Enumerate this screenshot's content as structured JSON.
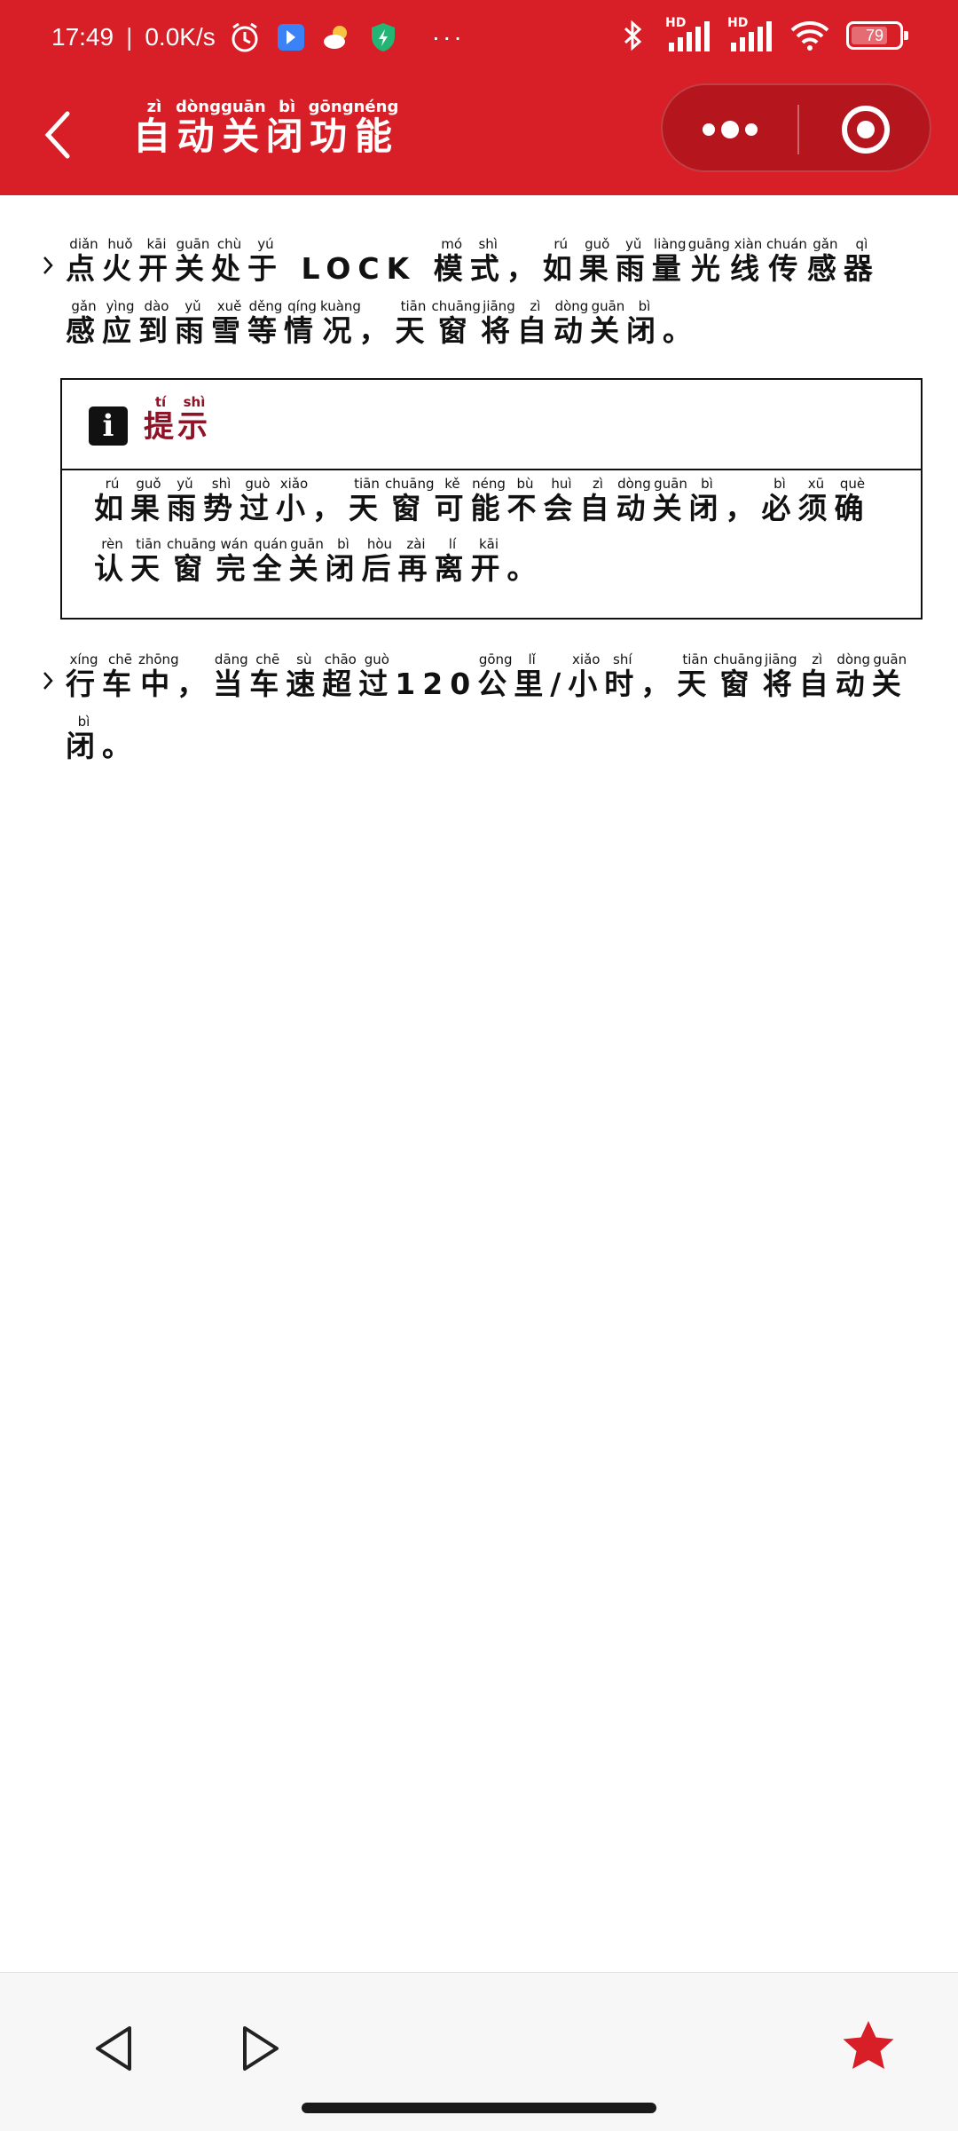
{
  "status_bar": {
    "time": "17:49",
    "separator": "|",
    "net_speed": "0.0K/s",
    "dots": "···",
    "hd_1": "HD",
    "hd_2": "HD",
    "battery": "79",
    "battery_level": 0.79
  },
  "nav": {
    "title": [
      {
        "char": "自",
        "py": "zì"
      },
      {
        "char": "动",
        "py": "dòng"
      },
      {
        "char": "关",
        "py": "guān"
      },
      {
        "char": "闭",
        "py": "bì"
      },
      {
        "char": "功",
        "py": "gōng"
      },
      {
        "char": "能",
        "py": "néng"
      }
    ]
  },
  "content": {
    "para1": [
      {
        "char": "点",
        "py": "diǎn"
      },
      {
        "char": "火",
        "py": "huǒ"
      },
      {
        "char": "开",
        "py": "kāi"
      },
      {
        "char": "关",
        "py": "guān"
      },
      {
        "char": "处",
        "py": "chù"
      },
      {
        "char": "于",
        "py": "yú"
      },
      {
        "char": " LOCK ",
        "py": ""
      },
      {
        "char": "模",
        "py": "mó"
      },
      {
        "char": "式",
        "py": "shì"
      },
      {
        "char": "，",
        "py": ""
      },
      {
        "char": "如",
        "py": "rú"
      },
      {
        "char": "果",
        "py": "guǒ"
      },
      {
        "char": "雨",
        "py": "yǔ"
      },
      {
        "char": "量",
        "py": "liàng"
      },
      {
        "char": "光",
        "py": "guāng"
      },
      {
        "char": "线",
        "py": "xiàn"
      },
      {
        "char": "传",
        "py": "chuán"
      },
      {
        "char": "感",
        "py": "gǎn"
      },
      {
        "char": "器",
        "py": "qì"
      },
      {
        "char": "感",
        "py": "gǎn"
      },
      {
        "char": "应",
        "py": "yìng"
      },
      {
        "char": "到",
        "py": "dào"
      },
      {
        "char": "雨",
        "py": "yǔ"
      },
      {
        "char": "雪",
        "py": "xuě"
      },
      {
        "char": "等",
        "py": "děng"
      },
      {
        "char": "情",
        "py": "qíng"
      },
      {
        "char": "况",
        "py": "kuàng"
      },
      {
        "char": "，",
        "py": ""
      },
      {
        "char": "天",
        "py": "tiān"
      },
      {
        "char": "窗",
        "py": "chuāng"
      },
      {
        "char": "将",
        "py": "jiāng"
      },
      {
        "char": "自",
        "py": "zì"
      },
      {
        "char": "动",
        "py": "dòng"
      },
      {
        "char": "关",
        "py": "guān"
      },
      {
        "char": "闭",
        "py": "bì"
      },
      {
        "char": "。",
        "py": ""
      }
    ],
    "tip": {
      "label": [
        {
          "char": "提",
          "py": "tí"
        },
        {
          "char": "示",
          "py": "shì"
        }
      ],
      "icon_glyph": "i",
      "body": [
        {
          "char": "如",
          "py": "rú"
        },
        {
          "char": "果",
          "py": "guǒ"
        },
        {
          "char": "雨",
          "py": "yǔ"
        },
        {
          "char": "势",
          "py": "shì"
        },
        {
          "char": "过",
          "py": "guò"
        },
        {
          "char": "小",
          "py": "xiǎo"
        },
        {
          "char": "，",
          "py": ""
        },
        {
          "char": "天",
          "py": "tiān"
        },
        {
          "char": "窗",
          "py": "chuāng"
        },
        {
          "char": "可",
          "py": "kě"
        },
        {
          "char": "能",
          "py": "néng"
        },
        {
          "char": "不",
          "py": "bù"
        },
        {
          "char": "会",
          "py": "huì"
        },
        {
          "char": "自",
          "py": "zì"
        },
        {
          "char": "动",
          "py": "dòng"
        },
        {
          "char": "关",
          "py": "guān"
        },
        {
          "char": "闭",
          "py": "bì"
        },
        {
          "char": "，",
          "py": ""
        },
        {
          "char": "必",
          "py": "bì"
        },
        {
          "char": "须",
          "py": "xū"
        },
        {
          "char": "确",
          "py": "què"
        },
        {
          "char": "认",
          "py": "rèn"
        },
        {
          "char": "天",
          "py": "tiān"
        },
        {
          "char": "窗",
          "py": "chuāng"
        },
        {
          "char": "完",
          "py": "wán"
        },
        {
          "char": "全",
          "py": "quán"
        },
        {
          "char": "关",
          "py": "guān"
        },
        {
          "char": "闭",
          "py": "bì"
        },
        {
          "char": "后",
          "py": "hòu"
        },
        {
          "char": "再",
          "py": "zài"
        },
        {
          "char": "离",
          "py": "lí"
        },
        {
          "char": "开",
          "py": "kāi"
        },
        {
          "char": "。",
          "py": ""
        }
      ]
    },
    "para2": [
      {
        "char": "行",
        "py": "xíng"
      },
      {
        "char": "车",
        "py": "chē"
      },
      {
        "char": "中",
        "py": "zhōng"
      },
      {
        "char": "，",
        "py": ""
      },
      {
        "char": "当",
        "py": "dāng"
      },
      {
        "char": "车",
        "py": "chē"
      },
      {
        "char": "速",
        "py": "sù"
      },
      {
        "char": "超",
        "py": "chāo"
      },
      {
        "char": "过",
        "py": "guò"
      },
      {
        "char": "120",
        "py": ""
      },
      {
        "char": "公",
        "py": "gōng"
      },
      {
        "char": "里",
        "py": "lǐ"
      },
      {
        "char": "/",
        "py": ""
      },
      {
        "char": "小",
        "py": "xiǎo"
      },
      {
        "char": "时",
        "py": "shí"
      },
      {
        "char": "，",
        "py": ""
      },
      {
        "char": "天",
        "py": "tiān"
      },
      {
        "char": "窗",
        "py": "chuāng"
      },
      {
        "char": "将",
        "py": "jiāng"
      },
      {
        "char": "自",
        "py": "zì"
      },
      {
        "char": "动",
        "py": "dòng"
      },
      {
        "char": "关",
        "py": "guān"
      },
      {
        "char": "闭",
        "py": "bì"
      },
      {
        "char": "。",
        "py": ""
      }
    ]
  },
  "icons": {
    "back": "back-arrow-icon",
    "more": "more-dots-icon",
    "close": "close-circle-icon",
    "prev": "prev-triangle-icon",
    "next": "next-triangle-icon",
    "favorite": "star-icon",
    "favorite_color": "#d81e27",
    "header_color": "#d81e27",
    "tip_title_color": "#8e1326"
  }
}
